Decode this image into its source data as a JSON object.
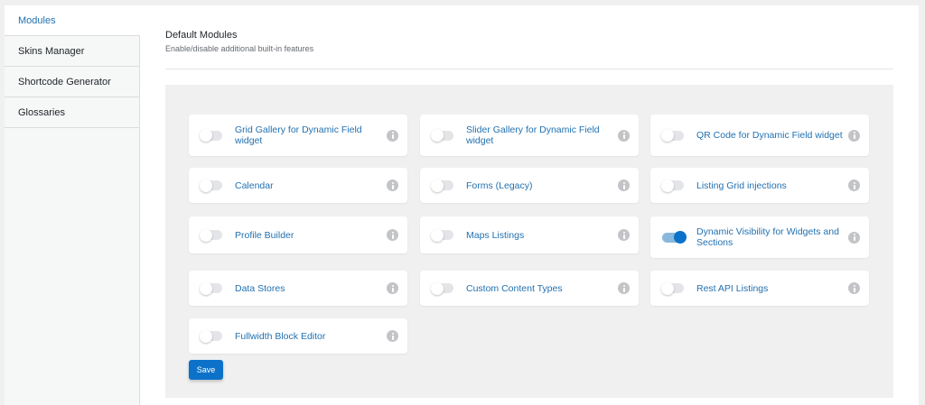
{
  "sidebar": {
    "items": [
      {
        "label": "Modules",
        "active": true
      },
      {
        "label": "Skins Manager"
      },
      {
        "label": "Shortcode Generator"
      },
      {
        "label": "Glossaries"
      }
    ]
  },
  "section": {
    "title": "Default Modules",
    "subtitle": "Enable/disable additional built-in features"
  },
  "modules": [
    {
      "label": "Grid Gallery for Dynamic Field widget",
      "enabled": false
    },
    {
      "label": "Slider Gallery for Dynamic Field widget",
      "enabled": false
    },
    {
      "label": "QR Code for Dynamic Field widget",
      "enabled": false
    },
    {
      "label": "Calendar",
      "enabled": false
    },
    {
      "label": "Forms (Legacy)",
      "enabled": false
    },
    {
      "label": "Listing Grid injections",
      "enabled": false
    },
    {
      "label": "Profile Builder",
      "enabled": false
    },
    {
      "label": "Maps Listings",
      "enabled": false
    },
    {
      "label": "Dynamic Visibility for Widgets and Sections",
      "enabled": true
    },
    {
      "label": "Data Stores",
      "enabled": false
    },
    {
      "label": "Custom Content Types",
      "enabled": false
    },
    {
      "label": "Rest API Listings",
      "enabled": false
    },
    {
      "label": "Fullwidth Block Editor",
      "enabled": false
    }
  ],
  "save_label": "Save",
  "colors": {
    "accent": "#2271b1",
    "toggle_on": "#0c72c9",
    "button": "#0c72c9"
  }
}
